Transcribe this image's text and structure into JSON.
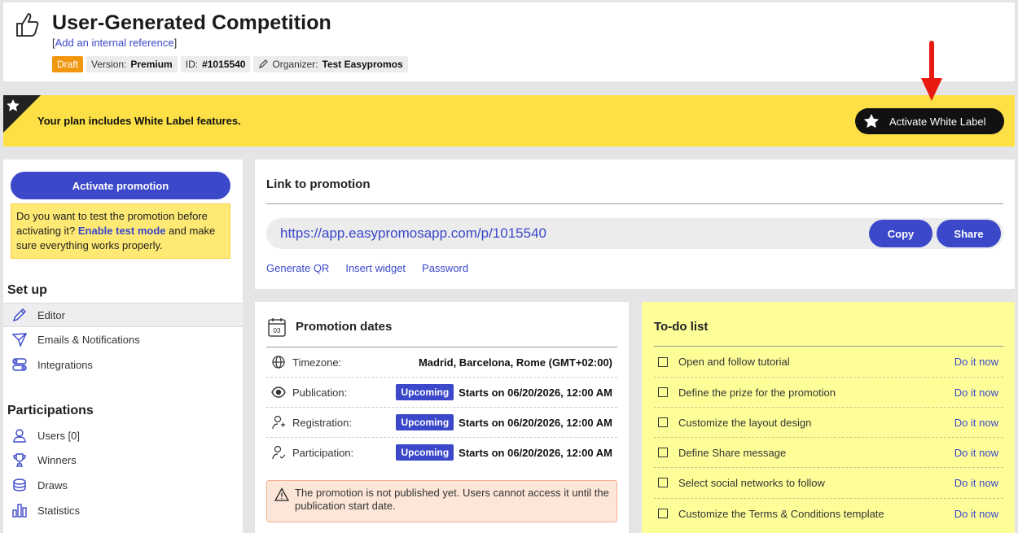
{
  "header": {
    "title": "User-Generated Competition",
    "ref_open": "[",
    "ref_link": "Add an internal reference",
    "ref_close": "]",
    "badges": {
      "draft": "Draft",
      "version_label": "Version:",
      "version_value": "Premium",
      "id_label": "ID:",
      "id_value": "#1015540",
      "organizer_label": "Organizer:",
      "organizer_value": "Test Easypromos"
    }
  },
  "banner": {
    "text": "Your plan includes White Label features.",
    "button": "Activate White Label"
  },
  "sidebar": {
    "activate_button": "Activate promotion",
    "test_text_1": "Do you want to test the promotion before activating it?",
    "test_link": "Enable test mode",
    "test_text_2": "and make sure everything works properly.",
    "setup_heading": "Set up",
    "setup_items": [
      "Editor",
      "Emails & Notifications",
      "Integrations"
    ],
    "participations_heading": "Participations",
    "participation_items": [
      "Users [0]",
      "Winners",
      "Draws",
      "Statistics"
    ]
  },
  "link_card": {
    "heading": "Link to promotion",
    "url": "https://app.easypromosapp.com/p/1015540",
    "copy": "Copy",
    "share": "Share",
    "links": [
      "Generate QR",
      "Insert widget",
      "Password"
    ]
  },
  "dates_card": {
    "heading": "Promotion dates",
    "calendar_day": "03",
    "timezone_label": "Timezone:",
    "timezone_value": "Madrid, Barcelona, Rome (GMT+02:00)",
    "rows": [
      {
        "label": "Publication:",
        "status": "Upcoming",
        "value": "Starts on 06/20/2026, 12:00 AM"
      },
      {
        "label": "Registration:",
        "status": "Upcoming",
        "value": "Starts on 06/20/2026, 12:00 AM"
      },
      {
        "label": "Participation:",
        "status": "Upcoming",
        "value": "Starts on 06/20/2026, 12:00 AM"
      }
    ],
    "warning": "The promotion is not published yet. Users cannot access it until the publication start date."
  },
  "todo_card": {
    "heading": "To-do list",
    "action": "Do it now",
    "items": [
      "Open and follow tutorial",
      "Define the prize for the promotion",
      "Customize the layout design",
      "Define Share message",
      "Select social networks to follow",
      "Customize the Terms & Conditions template"
    ]
  },
  "colors": {
    "accent": "#3b48c9",
    "banner": "#fde046",
    "draft": "#f0960f",
    "todo_bg": "#fefe99",
    "arrow": "#e8190e"
  }
}
